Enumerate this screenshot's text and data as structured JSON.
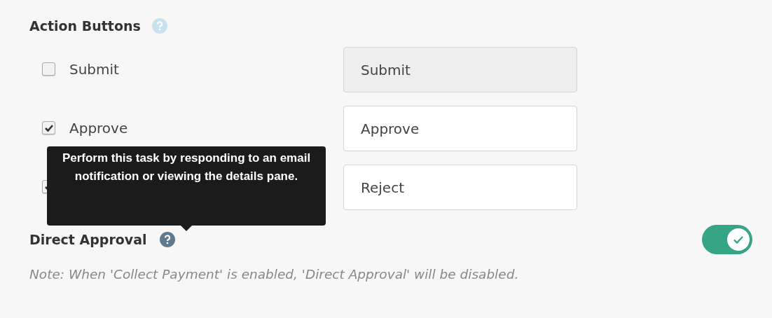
{
  "action_buttons": {
    "title": "Action Buttons",
    "rows": [
      {
        "label": "Submit",
        "checked": false,
        "value": "Submit",
        "disabled": true
      },
      {
        "label": "Approve",
        "checked": true,
        "value": "Approve",
        "disabled": false
      },
      {
        "checked": true,
        "value": "Reject",
        "disabled": false
      }
    ]
  },
  "tooltip": {
    "text": "Perform this task by responding to an email notification or viewing the details pane."
  },
  "direct_approval": {
    "label": "Direct Approval",
    "on": true,
    "note": "Note: When 'Collect Payment' is enabled, 'Direct Approval' will be disabled."
  }
}
